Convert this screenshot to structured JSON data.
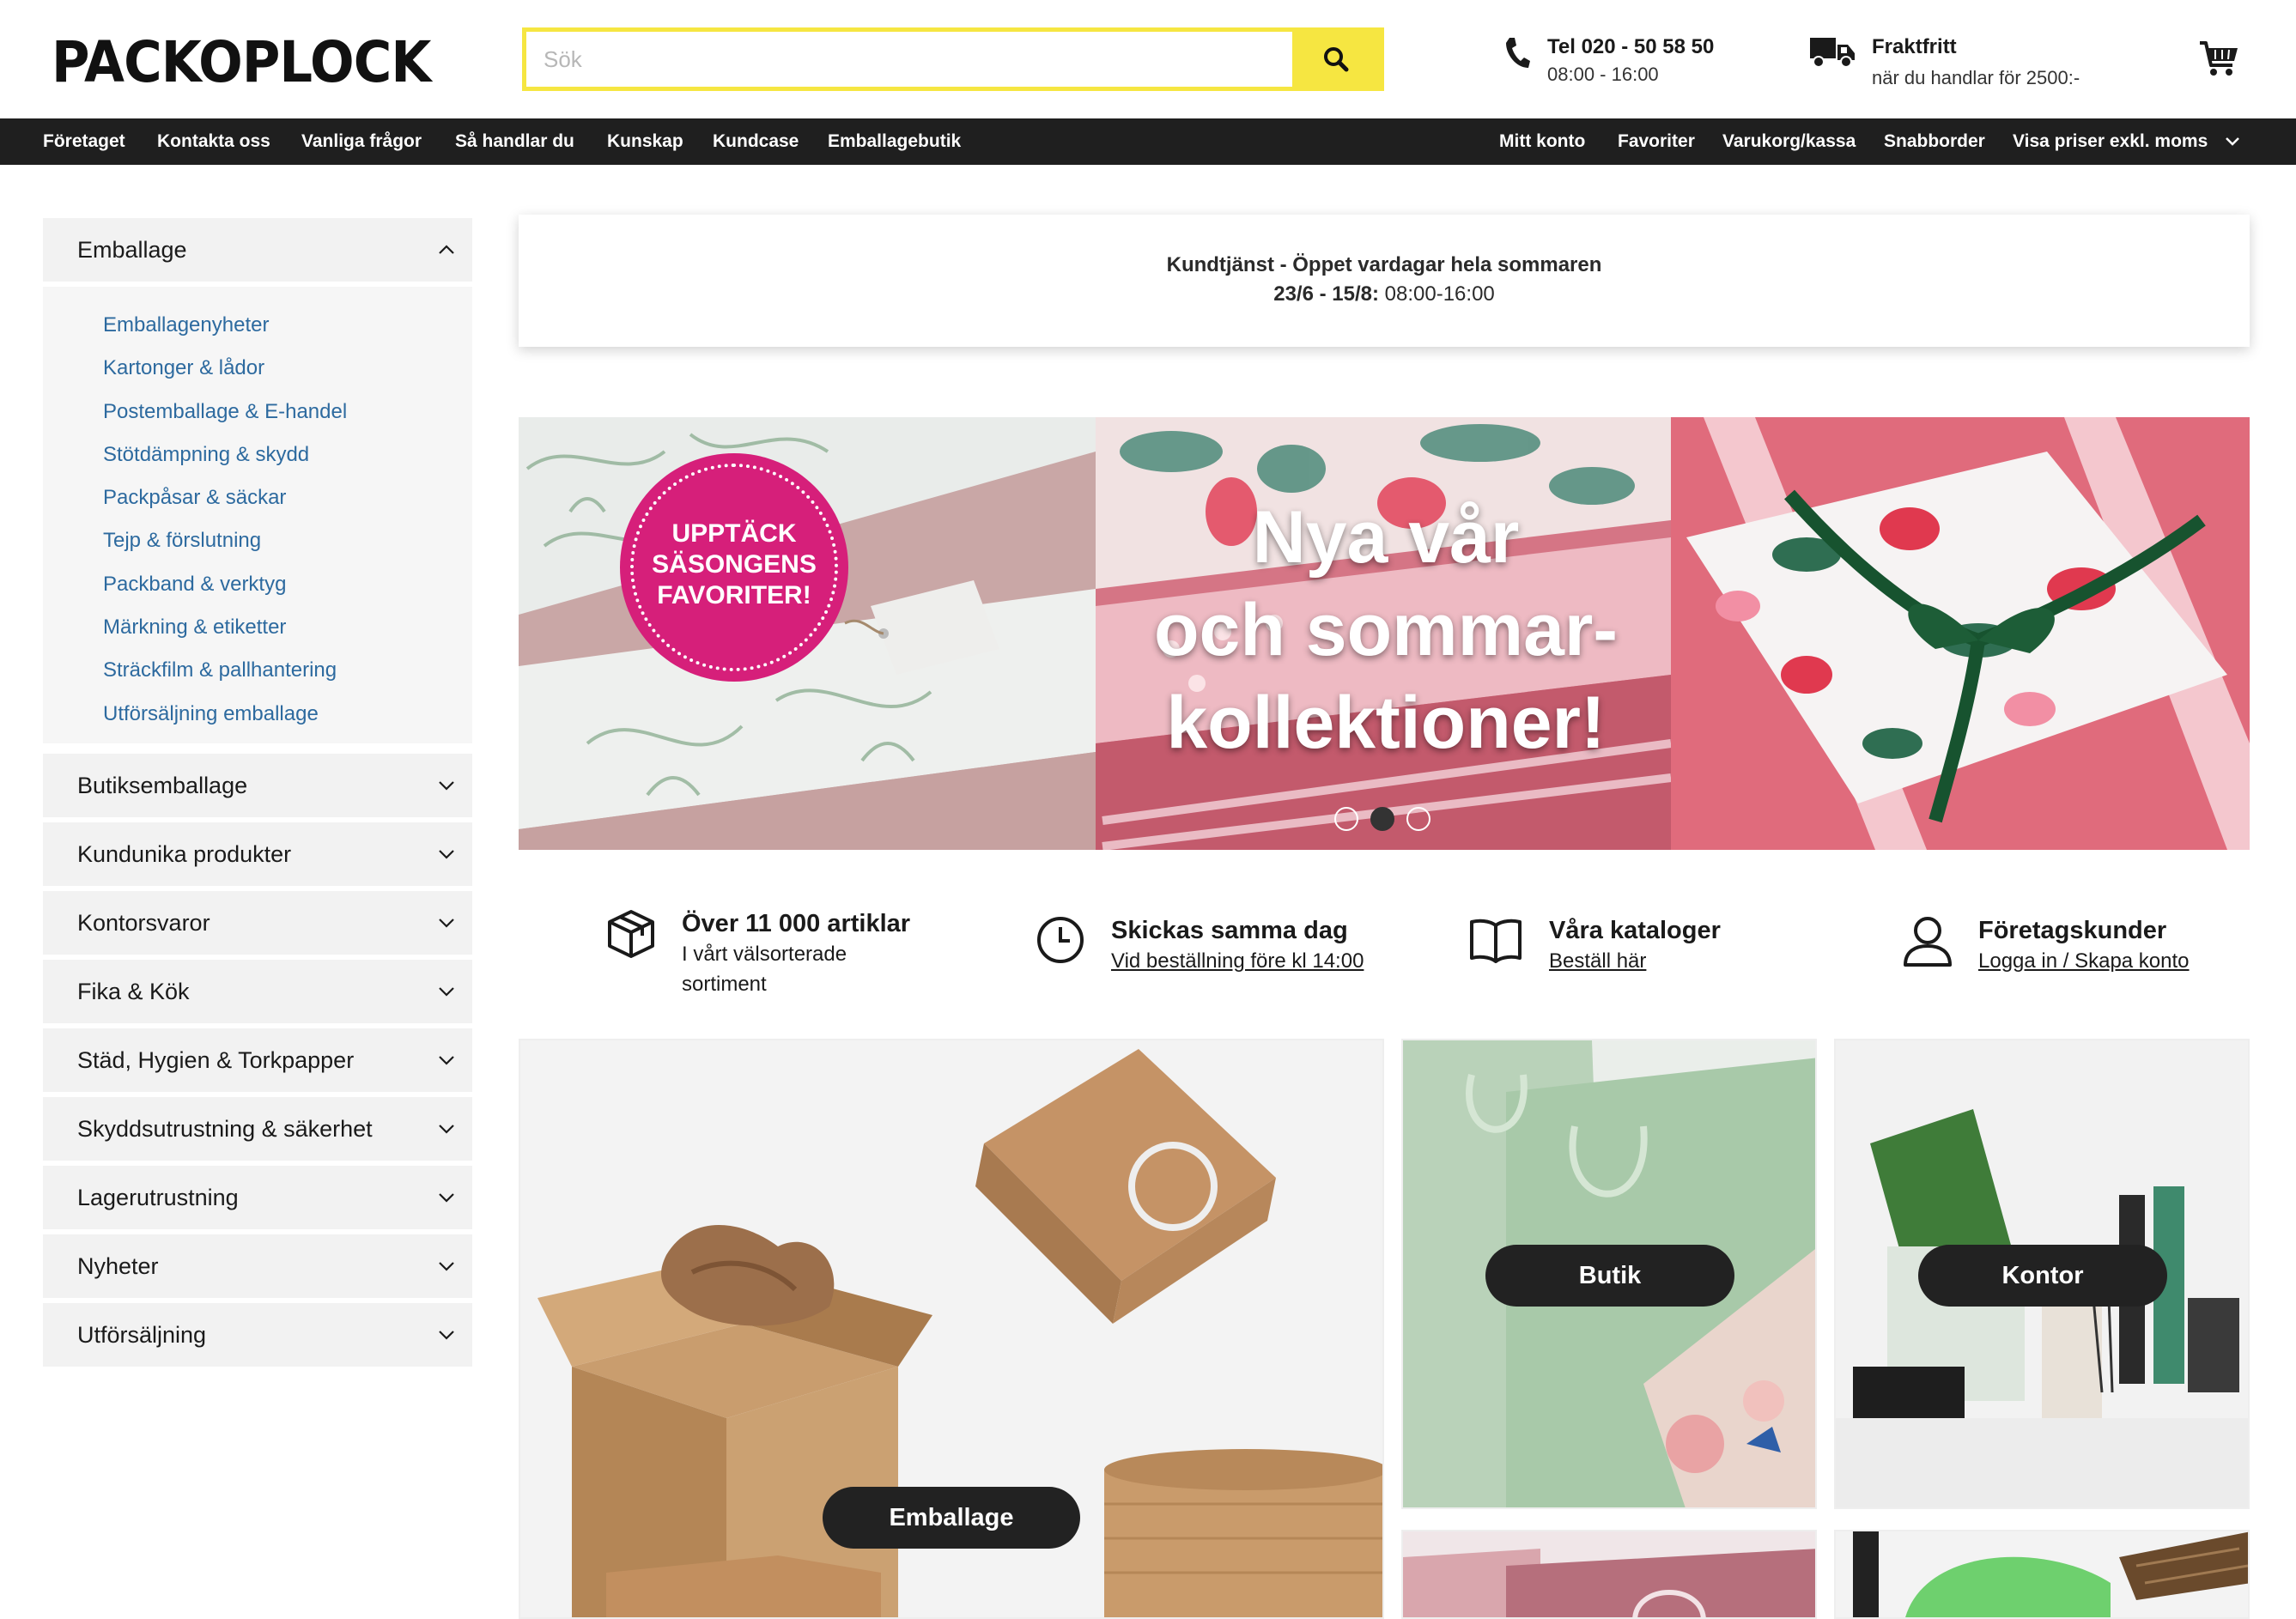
{
  "header": {
    "logo": "PACKOPLOCK",
    "search_placeholder": "Sök",
    "phone": {
      "line1": "Tel 020 - 50 58 50",
      "line2": "08:00 - 16:00"
    },
    "shipping": {
      "line1": "Fraktfritt",
      "line2": "när du handlar för 2500:-"
    }
  },
  "nav": {
    "left": [
      "Företaget",
      "Kontakta oss",
      "Vanliga frågor",
      "Så handlar du",
      "Kunskap",
      "Kundcase",
      "Emballagebutik"
    ],
    "right": [
      "Mitt konto",
      "Favoriter",
      "Varukorg/kassa",
      "Snabborder",
      "Visa priser exkl. moms"
    ]
  },
  "sidebar": {
    "expanded": {
      "label": "Emballage",
      "items": [
        "Emballagenyheter",
        "Kartonger & lådor",
        "Postemballage & E-handel",
        "Stötdämpning & skydd",
        "Packpåsar & säckar",
        "Tejp & förslutning",
        "Packband & verktyg",
        "Märkning & etiketter",
        "Sträckfilm & pallhantering",
        "Utförsäljning emballage"
      ]
    },
    "categories": [
      "Butiksemballage",
      "Kundunika produkter",
      "Kontorsvaror",
      "Fika & Kök",
      "Städ, Hygien & Torkpapper",
      "Skyddsutrustning & säkerhet",
      "Lagerutrustning",
      "Nyheter",
      "Utförsäljning"
    ]
  },
  "notice": {
    "line1": "Kundtjänst - Öppet vardagar hela sommaren",
    "line2_bold": "23/6 - 15/8:",
    "line2_rest": " 08:00-16:00"
  },
  "hero": {
    "badge": [
      "UPPTÄCK",
      "SÄSONGENS",
      "FAVORITER!"
    ],
    "title": [
      "Nya vår",
      "och sommar-",
      "kollektioner!"
    ],
    "slides": 3,
    "active_slide": 2
  },
  "usps": [
    {
      "icon": "box-icon",
      "title": "Över 11 000 artiklar",
      "text": "I vårt välsorterade sortiment"
    },
    {
      "icon": "clock-icon",
      "title": "Skickas samma dag",
      "link": "Vid beställning före kl 14:00"
    },
    {
      "icon": "book-icon",
      "title": "Våra kataloger",
      "link": "Beställ här"
    },
    {
      "icon": "user-icon",
      "title": "Företagskunder",
      "link": "Logga in / Skapa konto"
    }
  ],
  "tiles": {
    "emballage": "Emballage",
    "butik": "Butik",
    "kontor": "Kontor"
  },
  "colors": {
    "accent_yellow": "#f6e641",
    "nav_bg": "#1f1f1f",
    "link_blue": "#2d6a9f",
    "badge_pink": "#d61f7a"
  }
}
